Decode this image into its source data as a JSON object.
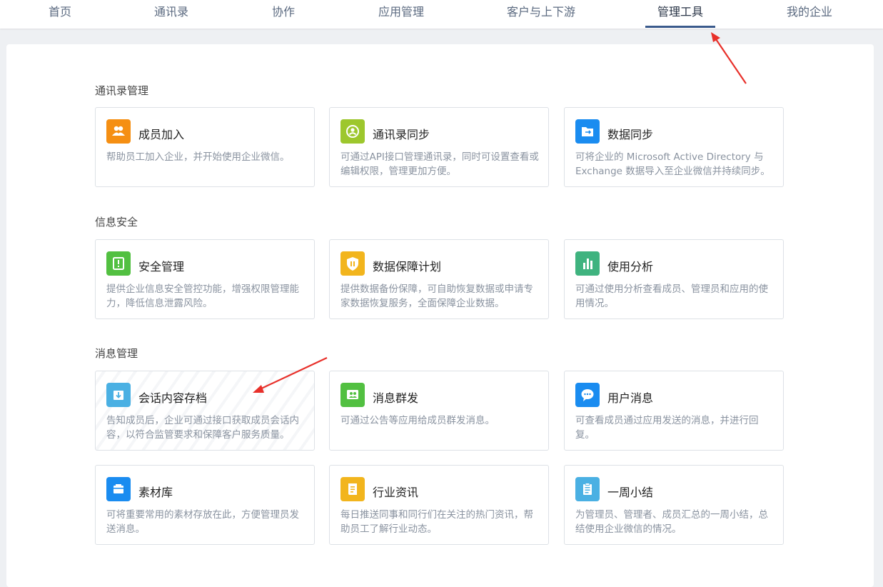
{
  "nav": {
    "tabs": [
      "首页",
      "通讯录",
      "协作",
      "应用管理",
      "客户与上下游",
      "管理工具",
      "我的企业"
    ],
    "active": "管理工具"
  },
  "sections": {
    "contacts": {
      "title": "通讯录管理",
      "cards": [
        {
          "title": "成员加入",
          "desc": "帮助员工加入企业，并开始使用企业微信。",
          "icon": "members-join-icon",
          "color": "#f58f13"
        },
        {
          "title": "通讯录同步",
          "desc": "可通过API接口管理通讯录，同时可设置查看或编辑权限，管理更加方便。",
          "icon": "contact-sync-icon",
          "color": "#9dc72d"
        },
        {
          "title": "数据同步",
          "desc": "可将企业的 Microsoft Active Directory 与 Exchange 数据导入至企业微信并持续同步。",
          "icon": "folder-sync-icon",
          "color": "#1a8cf0"
        }
      ]
    },
    "security": {
      "title": "信息安全",
      "cards": [
        {
          "title": "安全管理",
          "desc": "提供企业信息安全管控功能，增强权限管理能力，降低信息泄露风险。",
          "icon": "security-alert-icon",
          "color": "#52c041"
        },
        {
          "title": "数据保障计划",
          "desc": "提供数据备份保障，可自助恢复数据或申请专家数据恢复服务，全面保障企业数据。",
          "icon": "shield-icon",
          "color": "#f2b51d"
        },
        {
          "title": "使用分析",
          "desc": "可通过使用分析查看成员、管理员和应用的使用情况。",
          "icon": "bar-chart-icon",
          "color": "#3fb37f"
        }
      ]
    },
    "messages": {
      "title": "消息管理",
      "cards": [
        {
          "title": "会话内容存档",
          "desc": "告知成员后，企业可通过接口获取成员会话内容，以符合监管要求和保障客户服务质量。",
          "icon": "archive-download-icon",
          "color": "#4ab0e3"
        },
        {
          "title": "消息群发",
          "desc": "可通过公告等应用给成员群发消息。",
          "icon": "group-message-icon",
          "color": "#52c041"
        },
        {
          "title": "用户消息",
          "desc": "可查看成员通过应用发送的消息，并进行回复。",
          "icon": "chat-bubble-icon",
          "color": "#1a8cf0"
        },
        {
          "title": "素材库",
          "desc": "可将重要常用的素材存放在此，方便管理员发送消息。",
          "icon": "material-box-icon",
          "color": "#1a8cf0"
        },
        {
          "title": "行业资讯",
          "desc": "每日推送同事和同行们在关注的热门资讯，帮助员工了解行业动态。",
          "icon": "news-doc-icon",
          "color": "#f2b51d"
        },
        {
          "title": "一周小结",
          "desc": "为管理员、管理者、成员汇总的一周小结，总结使用企业微信的情况。",
          "icon": "clipboard-icon",
          "color": "#4ab0e3"
        }
      ]
    }
  },
  "annotation_color": "#e8302a"
}
